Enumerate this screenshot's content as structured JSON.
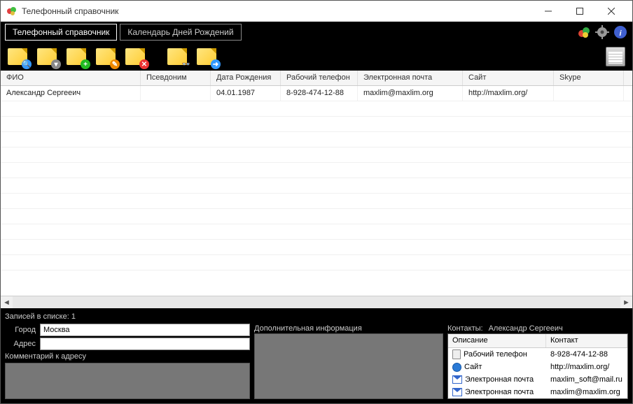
{
  "window": {
    "title": "Телефонный справочник"
  },
  "tabs": {
    "directory": "Телефонный справочник",
    "calendar": "Календарь Дней Рождений"
  },
  "toolbar_icons": {
    "search": "search-note",
    "filter": "filter-note",
    "add": "add-note",
    "edit": "edit-note",
    "delete": "delete-note",
    "find": "find-note",
    "export": "export-note",
    "calendar": "calendar"
  },
  "top_icons": {
    "balls": "balls-icon",
    "gear": "gear-icon",
    "info": "info-icon"
  },
  "grid": {
    "headers": {
      "fio": "ФИО",
      "pseudo": "Псевдоним",
      "dob": "Дата Рождения",
      "wphone": "Рабочий телефон",
      "email": "Электронная почта",
      "site": "Сайт",
      "skype": "Skype"
    },
    "rows": [
      {
        "fio": "Александр Сергееич",
        "pseudo": "",
        "dob": "04.01.1987",
        "wphone": "8-928-474-12-88",
        "email": "maxlim@maxlim.org",
        "site": "http://maxlim.org/",
        "skype": ""
      }
    ]
  },
  "footer": {
    "records": "Записей в списке: 1",
    "city_label": "Город",
    "city_value": "Москва",
    "address_label": "Адрес",
    "address_value": "",
    "address_comment_label": "Комментарий к адресу",
    "extra_info_label": "Дополнительная информация",
    "contacts_prefix": "Контакты:",
    "contacts_name": "Александр Сергееич",
    "ct_headers": {
      "desc": "Описание",
      "contact": "Контакт"
    },
    "ct_rows": [
      {
        "icon": "phone",
        "desc": "Рабочий телефон",
        "val": "8-928-474-12-88"
      },
      {
        "icon": "globe",
        "desc": "Сайт",
        "val": "http://maxlim.org/"
      },
      {
        "icon": "mail",
        "desc": "Электронная почта",
        "val": "maxlim_soft@mail.ru"
      },
      {
        "icon": "mail",
        "desc": "Электронная почта",
        "val": "maxlim@maxlim.org"
      }
    ]
  }
}
